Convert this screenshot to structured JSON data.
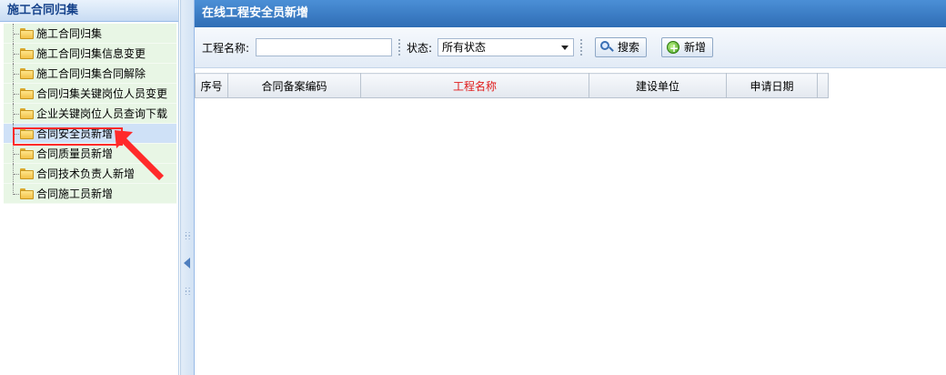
{
  "sidebar": {
    "title": "施工合同归集",
    "items": [
      {
        "label": "施工合同归集"
      },
      {
        "label": "施工合同归集信息变更"
      },
      {
        "label": "施工合同归集合同解除"
      },
      {
        "label": "合同归集关键岗位人员变更"
      },
      {
        "label": "企业关键岗位人员查询下载"
      },
      {
        "label": "合同安全员新增",
        "selected": true
      },
      {
        "label": "合同质量员新增"
      },
      {
        "label": "合同技术负责人新增"
      },
      {
        "label": "合同施工员新增"
      }
    ]
  },
  "main": {
    "title": "在线工程安全员新增",
    "toolbar": {
      "project_name_label": "工程名称:",
      "project_name_value": "",
      "status_label": "状态:",
      "status_value": "所有状态",
      "search_label": "搜索",
      "add_label": "新增"
    },
    "table": {
      "columns": [
        "序号",
        "合同备案编码",
        "工程名称",
        "建设单位",
        "申请日期",
        ""
      ],
      "highlight_column": "工程名称"
    }
  },
  "colors": {
    "header_blue": "#2f6db5",
    "highlight_red": "#ff2a2a",
    "tree_bg": "#e8f6e5",
    "selected_bg": "#cfe1f7"
  }
}
